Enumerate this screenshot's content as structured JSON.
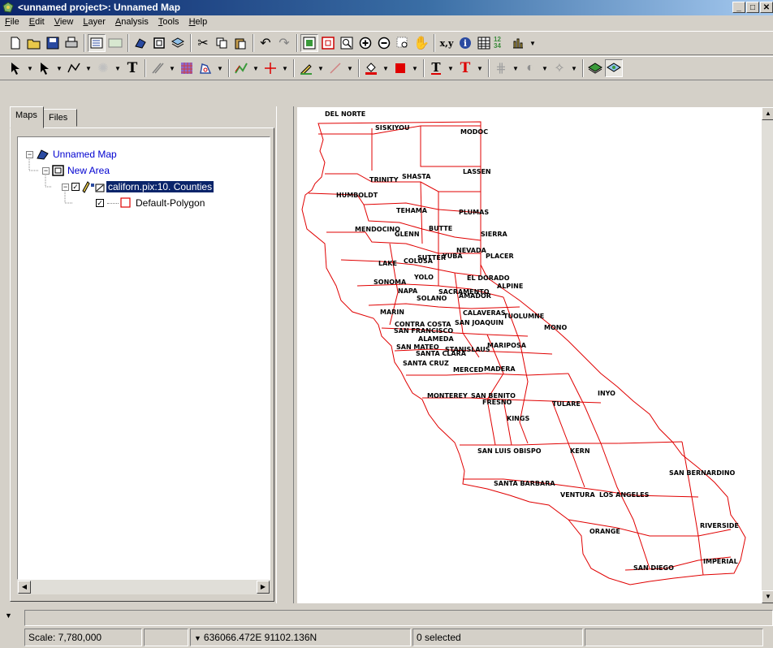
{
  "window": {
    "title": "<unnamed project>: Unnamed Map",
    "minimize": "_",
    "maximize": "□",
    "close": "✕"
  },
  "menu": [
    {
      "label": "File",
      "key": "F",
      "rest": "ile"
    },
    {
      "label": "Edit",
      "key": "E",
      "rest": "dit"
    },
    {
      "label": "View",
      "key": "V",
      "rest": "iew"
    },
    {
      "label": "Layer",
      "key": "L",
      "rest": "ayer"
    },
    {
      "label": "Analysis",
      "key": "A",
      "rest": "nalysis"
    },
    {
      "label": "Tools",
      "key": "T",
      "rest": "ools"
    },
    {
      "label": "Help",
      "key": "H",
      "rest": "elp"
    }
  ],
  "toolbar1": {
    "xy_label": "x,y",
    "info_label": "i",
    "num_label": "12 34"
  },
  "toolbar2": {
    "text_label": "T"
  },
  "left_panel": {
    "tabs": [
      {
        "label": "Maps",
        "active": true
      },
      {
        "label": "Files",
        "active": false
      }
    ],
    "tree": {
      "map": "Unnamed Map",
      "area": "New Area",
      "layer": "californ.pix:10. Counties",
      "style": "Default-Polygon"
    }
  },
  "map": {
    "line_color": "#e00000",
    "counties": [
      "DEL NORTE",
      "SISKIYOU",
      "MODOC",
      "TRINITY",
      "SHASTA",
      "LASSEN",
      "HUMBOLDT",
      "TEHAMA",
      "PLUMAS",
      "MENDOCINO",
      "GLENN",
      "BUTTE",
      "SIERRA",
      "NEVADA",
      "SUTTER",
      "PLACER",
      "YUBA",
      "LAKE",
      "COLUSA",
      "YOLO",
      "EL DORADO",
      "ALPINE",
      "SONOMA",
      "NAPA",
      "SACRAMENTO",
      "SOLANO",
      "AMADOR",
      "MARIN",
      "CALAVERAS",
      "TUOLUMNE",
      "SAN FRANCISCO",
      "CONTRA COSTA",
      "SAN JOAQUIN",
      "MONO",
      "ALAMEDA",
      "SAN MATEO",
      "SANTA CLARA",
      "STANISLAUS",
      "MARIPOSA",
      "SANTA CRUZ",
      "MERCED",
      "MADERA",
      "MONTEREY",
      "SAN BENITO",
      "FRESNO",
      "TULARE",
      "INYO",
      "KINGS",
      "SAN LUIS OBISPO",
      "KERN",
      "SAN BERNARDINO",
      "SANTA BARBARA",
      "VENTURA",
      "LOS ANGELES",
      "ORANGE",
      "RIVERSIDE",
      "SAN DIEGO",
      "IMPERIAL"
    ]
  },
  "status": {
    "scale": "Scale: 7,780,000",
    "coords": "636066.472E 91102.136N",
    "selected": "0 selected"
  }
}
